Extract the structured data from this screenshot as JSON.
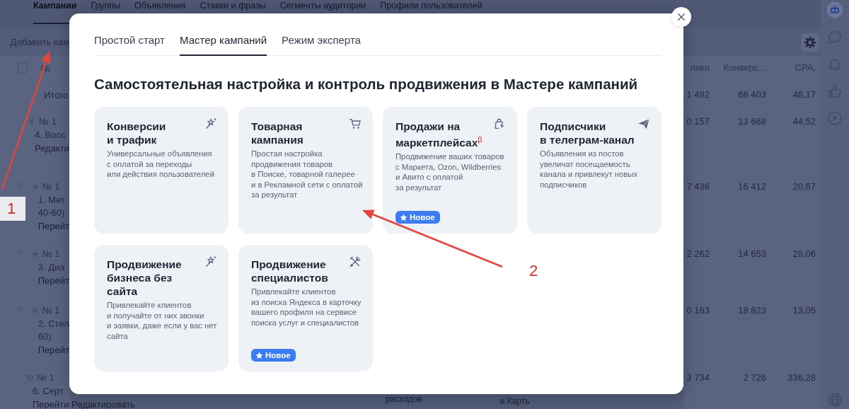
{
  "background_page": {
    "nav_tabs": [
      {
        "label": "Кампании",
        "selected": true
      },
      {
        "label": "Группы",
        "selected": false
      },
      {
        "label": "Объявления",
        "selected": false
      },
      {
        "label": "Ставки и фразы",
        "selected": false
      },
      {
        "label": "Сегменты аудитории",
        "selected": false
      },
      {
        "label": "Профили пользователей",
        "selected": false
      }
    ],
    "add_button": "Добавить кам",
    "table_header": {
      "number": "№",
      "columns": [
        "лики",
        "Конверс...",
        "CPA,"
      ]
    },
    "total_row": {
      "label": "Итого",
      "values": [
        "1 492",
        "68 403",
        "48,17"
      ]
    },
    "rows": [
      {
        "kind": "smart",
        "number": "№ 1",
        "title": "4. Восс",
        "link": "Редакти",
        "values": [
          "0 157",
          "13 668",
          "44,52"
        ]
      },
      {
        "kind": "smart",
        "number": "№ 1",
        "title": "1. Мет\n40-60)",
        "link": "Перейт",
        "values": [
          "7 436",
          "16 412",
          "20,67"
        ]
      },
      {
        "kind": "smart",
        "number": "№ 1",
        "title": "3. Диа",
        "link": "Перейт",
        "values": [
          "2 262",
          "14 653",
          "28,06"
        ]
      },
      {
        "kind": "smart",
        "number": "№ 1",
        "title": "2. Стел\n60)",
        "link": "Перейт",
        "values": [
          "0 163",
          "18 823",
          "13,05"
        ]
      },
      {
        "kind": "product",
        "number": "№ 1",
        "title": "6. Серт",
        "link": "Перейти  Редактировать",
        "values": [
          "3 734",
          "2 726",
          "336,28"
        ]
      }
    ],
    "bottom_fragments": [
      "расходов",
      "и Карть"
    ]
  },
  "dialog": {
    "tabs": [
      {
        "label": "Простой старт",
        "selected": false
      },
      {
        "label": "Мастер кампаний",
        "selected": true
      },
      {
        "label": "Режим эксперта",
        "selected": false
      }
    ],
    "heading": "Самостоятельная настройка и контроль продвижения в Мастере кампаний",
    "cards": [
      {
        "title": "Конверсии\nи трафик",
        "description": "Универсальные объявления\nс оплатой за переходы\nили действия пользователей"
      },
      {
        "title": "Товарная\nкампания",
        "description": "Простая настройка\nпродвижения товаров\nв Поиске, товарной галерее\nи в Рекламной сети с оплатой\nза результат"
      },
      {
        "title": "Продажи на\nмаркетплейсах$^{β}$",
        "description": "Продвижение ваших товаров\nс Маркета, Ozon, Wildberries\nи Авито с оплатой\nза результат",
        "badge": "Новое"
      },
      {
        "title": "Подписчики\nв телеграм-канал",
        "description": "Объявления из постов\nувеличат посещаемость\nканала и привлекут новых\nподписчиков"
      },
      {
        "title": "Продвижение\nбизнеса без сайта",
        "description": "Привлекайте клиентов\nи получайте от них звонки\nи заявки, даже если у вас нет\nсайта"
      },
      {
        "title": "Продвижение\nспециалистов",
        "description": "Привлекайте клиентов\nиз поиска Яндекса в карточку\nвашего профиля на сервисе\nпоиска услуг и специалистов",
        "badge": "Новое"
      }
    ]
  },
  "annotations": [
    {
      "label": "1",
      "kind": "boxed"
    },
    {
      "label": "2",
      "kind": "plain"
    }
  ]
}
